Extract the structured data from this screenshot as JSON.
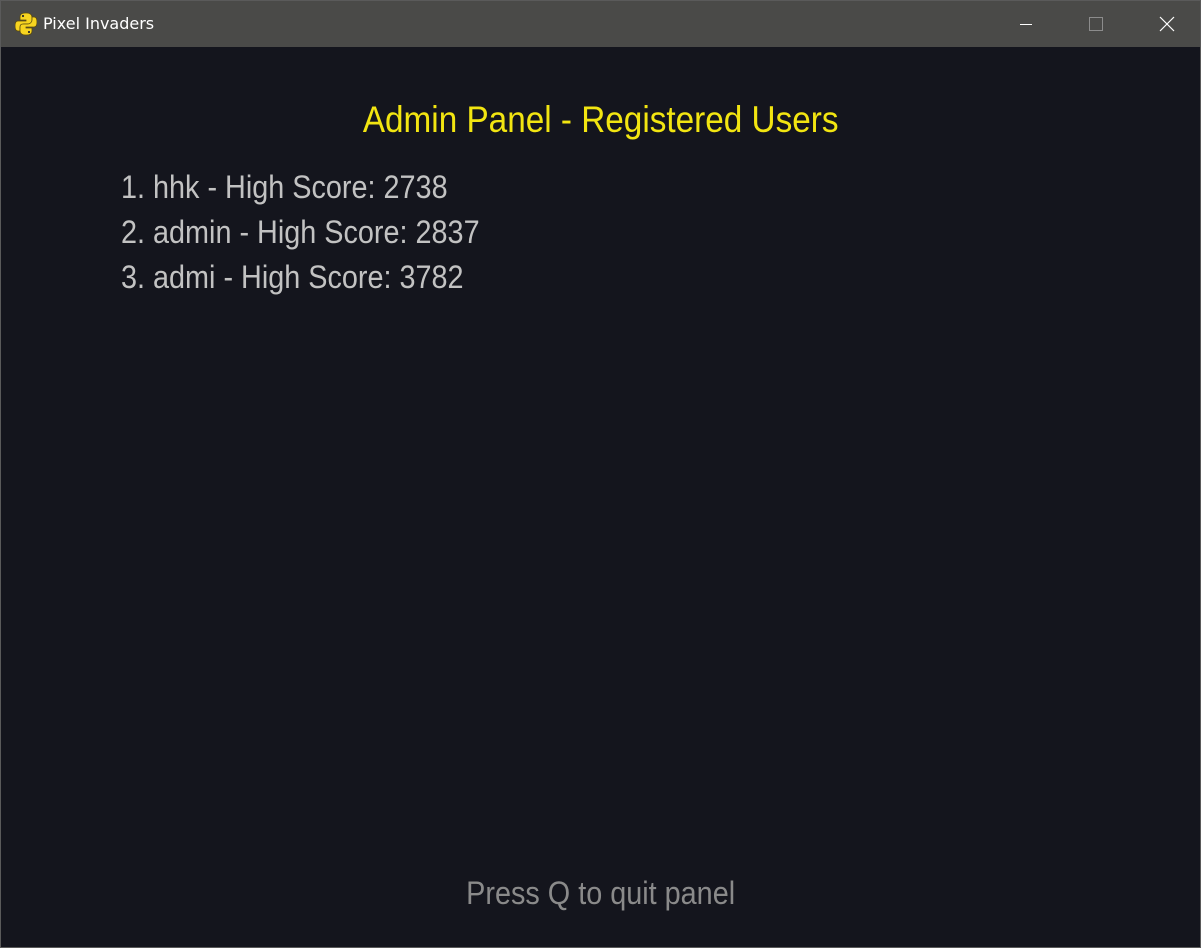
{
  "window": {
    "title": "Pixel Invaders",
    "icon": "python-snake-icon",
    "controls": {
      "minimize": "minimize-icon",
      "maximize": "maximize-icon",
      "close": "close-icon"
    }
  },
  "panel": {
    "title": "Admin Panel - Registered Users",
    "users": [
      {
        "text": "1. hhk - High Score: 2738"
      },
      {
        "text": "2. admin - High Score: 2837"
      },
      {
        "text": "3. admi - High Score: 3782"
      }
    ],
    "hint": "Press Q to quit panel"
  },
  "colors": {
    "background": "#14151d",
    "titlebar": "#4a4a48",
    "title_accent": "#f2e511",
    "list_text": "#c2c2c2",
    "hint_text": "#8a8a8a"
  }
}
